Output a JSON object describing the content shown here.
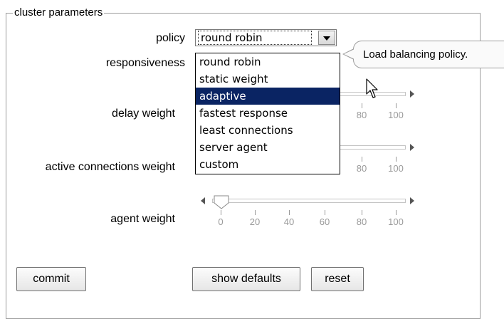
{
  "legend": "cluster parameters",
  "labels": {
    "policy": "policy",
    "responsiveness": "responsiveness",
    "delay_weight": "delay weight",
    "active_connections_weight": "active connections weight",
    "agent_weight": "agent weight"
  },
  "policy_select": {
    "value": "round robin",
    "options": [
      "round robin",
      "static weight",
      "adaptive",
      "fastest response",
      "least connections",
      "server agent",
      "custom"
    ],
    "highlighted": "adaptive"
  },
  "tooltip": "Load balancing policy.",
  "slider_ticks": [
    "0",
    "20",
    "40",
    "60",
    "80",
    "100"
  ],
  "sliders": {
    "agent_weight": {
      "value": 0
    }
  },
  "buttons": {
    "commit": "commit",
    "show_defaults": "show defaults",
    "reset": "reset"
  }
}
